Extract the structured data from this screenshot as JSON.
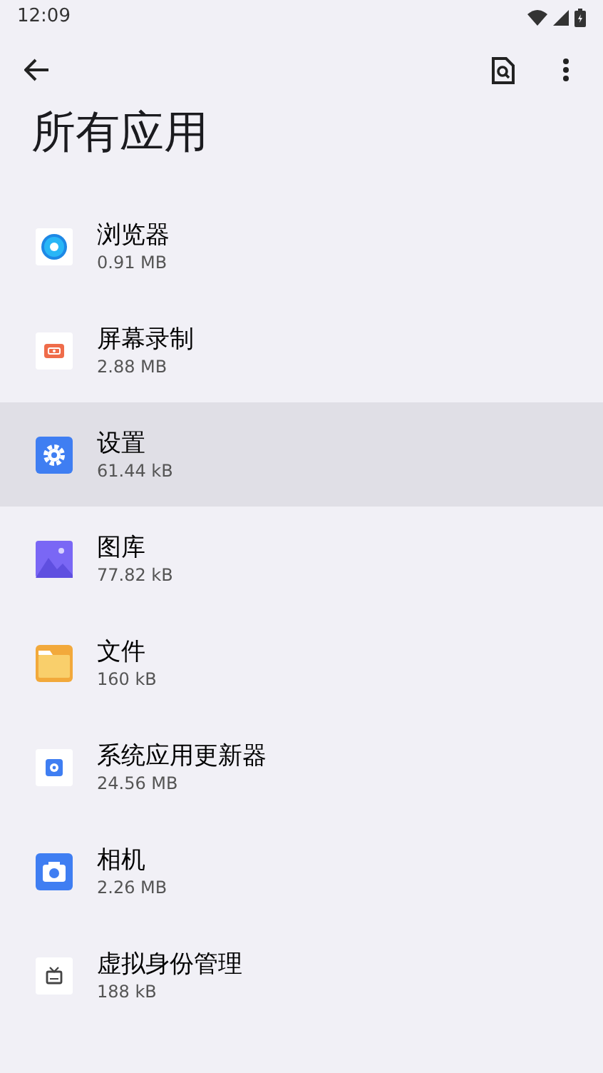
{
  "status_bar": {
    "time": "12:09"
  },
  "title": "所有应用",
  "apps": [
    {
      "name": "浏览器",
      "size": "0.91 MB",
      "selected": false
    },
    {
      "name": "屏幕录制",
      "size": "2.88 MB",
      "selected": false
    },
    {
      "name": "设置",
      "size": "61.44 kB",
      "selected": true
    },
    {
      "name": "图库",
      "size": "77.82 kB",
      "selected": false
    },
    {
      "name": "文件",
      "size": "160 kB",
      "selected": false
    },
    {
      "name": "系统应用更新器",
      "size": "24.56 MB",
      "selected": false
    },
    {
      "name": "相机",
      "size": "2.26 MB",
      "selected": false
    },
    {
      "name": "虚拟身份管理",
      "size": "188 kB",
      "selected": false
    }
  ]
}
